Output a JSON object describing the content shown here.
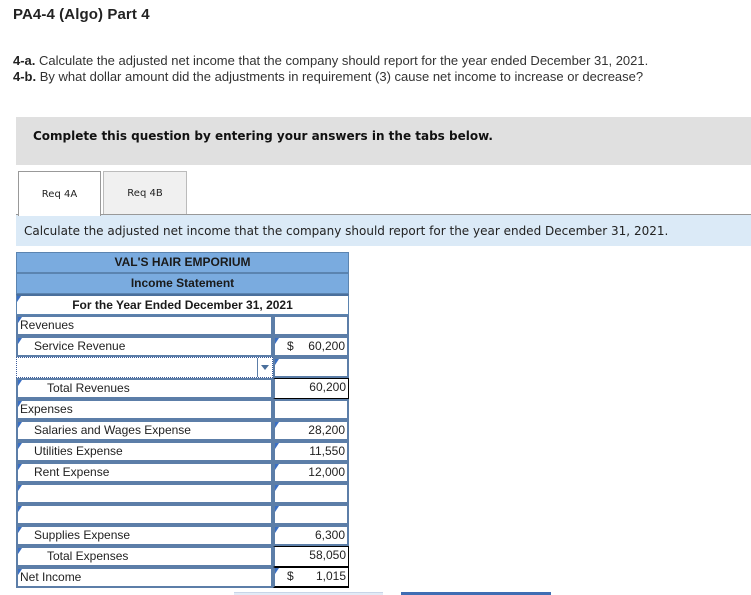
{
  "page": {
    "title": "PA4-4 (Algo) Part 4",
    "questions": [
      {
        "label": "4-a.",
        "text": " Calculate the adjusted net income that the company should report for the year ended December 31, 2021."
      },
      {
        "label": "4-b.",
        "text": " By what dollar amount did the adjustments in requirement (3) cause net income to increase or decrease?"
      }
    ]
  },
  "instruction": "Complete this question by entering your answers in the tabs below.",
  "tabs": [
    {
      "label": "Req 4A",
      "active": true
    },
    {
      "label": "Req 4B",
      "active": false
    }
  ],
  "prompt": "Calculate the adjusted net income that the company should report for the year ended December 31, 2021.",
  "statement": {
    "company": "VAL'S HAIR EMPORIUM",
    "title": "Income Statement",
    "period": "For the Year Ended December 31, 2021",
    "rows": [
      {
        "label": "Revenues",
        "amount": "",
        "currency": ""
      },
      {
        "label": "Service Revenue",
        "amount": "60,200",
        "currency": "$"
      },
      {
        "label": "",
        "amount": "",
        "currency": "",
        "dropdown": true
      },
      {
        "label": "Total Revenues",
        "amount": "60,200",
        "currency": ""
      },
      {
        "label": "Expenses",
        "amount": "",
        "currency": ""
      },
      {
        "label": "Salaries and Wages Expense",
        "amount": "28,200",
        "currency": ""
      },
      {
        "label": "Utilities Expense",
        "amount": "11,550",
        "currency": ""
      },
      {
        "label": "Rent Expense",
        "amount": "12,000",
        "currency": ""
      },
      {
        "label": "",
        "amount": "",
        "currency": ""
      },
      {
        "label": "",
        "amount": "",
        "currency": ""
      },
      {
        "label": "Supplies Expense",
        "amount": "6,300",
        "currency": ""
      },
      {
        "label": "Total Expenses",
        "amount": "58,050",
        "currency": ""
      },
      {
        "label": "Net Income",
        "amount": "1,015",
        "currency": "$"
      }
    ]
  },
  "nav": {
    "prev_label": "",
    "next_label": ""
  }
}
